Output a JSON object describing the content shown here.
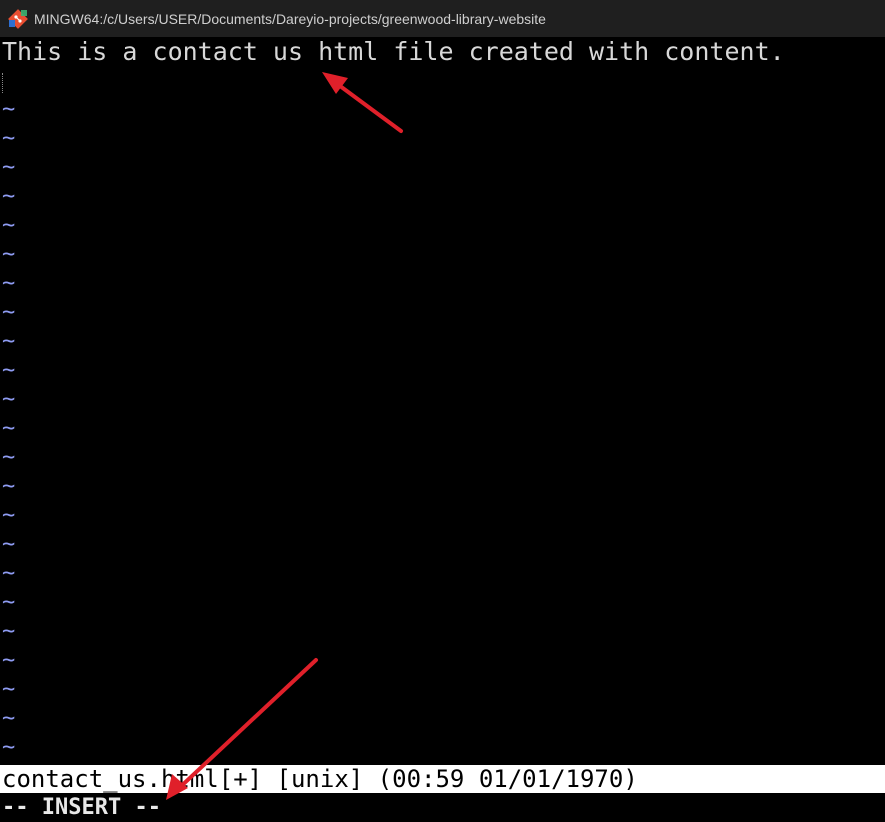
{
  "window": {
    "title": "MINGW64:/c/Users/USER/Documents/Dareyio-projects/greenwood-library-website",
    "icon": "git-bash-icon"
  },
  "editor": {
    "buffer_lines": [
      "This is a contact us html file created with content."
    ],
    "empty_line_marker": "~",
    "tilde_count": 23,
    "tilde_color": "#8f9cf3"
  },
  "statusline": {
    "text": "contact_us.html[+] [unix] (00:59 01/01/1970)"
  },
  "modeline": {
    "text": "-- INSERT --"
  },
  "annotations": {
    "arrow_color": "#e0202a"
  }
}
